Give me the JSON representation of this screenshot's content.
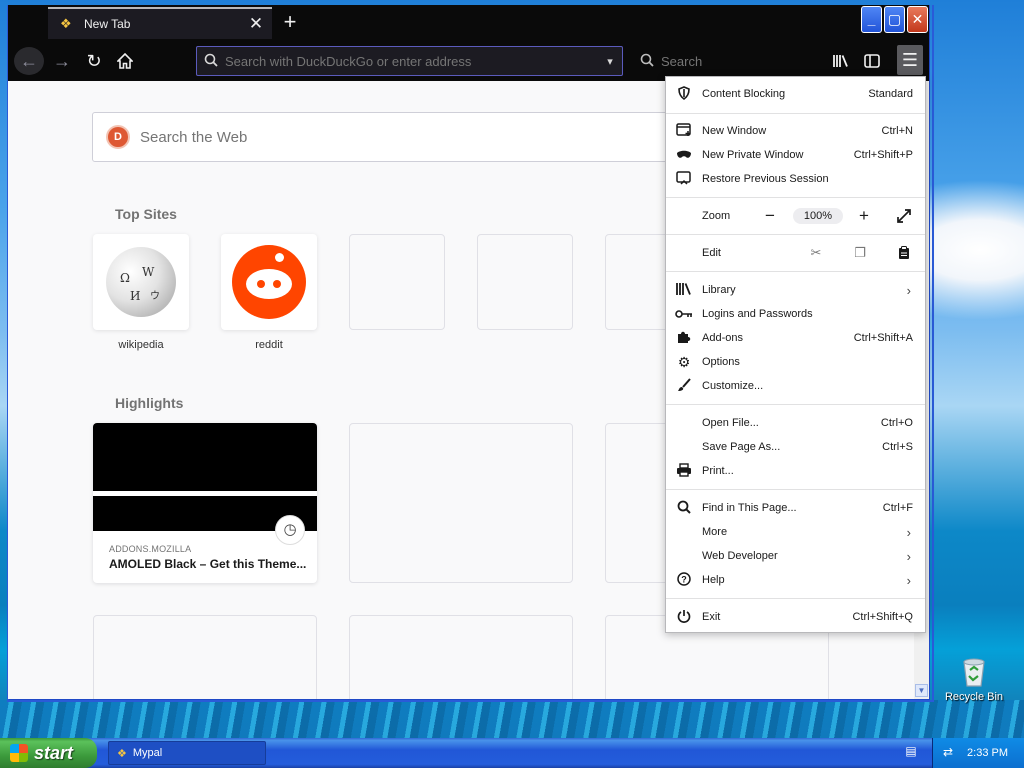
{
  "tab": {
    "title": "New Tab",
    "close": "✕",
    "new": "+"
  },
  "window_controls": {
    "minimize": "_",
    "maximize": "▢",
    "close": "✕"
  },
  "urlbar": {
    "placeholder": "Search with DuckDuckGo or enter address"
  },
  "searchbar": {
    "placeholder": "Search"
  },
  "content": {
    "websearch_placeholder": "Search the Web",
    "top_sites_heading": "Top Sites",
    "top_sites": [
      {
        "label": "wikipedia"
      },
      {
        "label": "reddit"
      }
    ],
    "highlights_heading": "Highlights",
    "highlight": {
      "source": "ADDONS.MOZILLA",
      "title": "AMOLED Black – Get this Theme..."
    }
  },
  "menu": {
    "content_blocking": {
      "label": "Content Blocking",
      "value": "Standard"
    },
    "new_window": {
      "label": "New Window",
      "shortcut": "Ctrl+N"
    },
    "new_private_window": {
      "label": "New Private Window",
      "shortcut": "Ctrl+Shift+P"
    },
    "restore_session": {
      "label": "Restore Previous Session"
    },
    "zoom": {
      "label": "Zoom",
      "level": "100%"
    },
    "edit": {
      "label": "Edit"
    },
    "library": {
      "label": "Library"
    },
    "logins": {
      "label": "Logins and Passwords"
    },
    "addons": {
      "label": "Add-ons",
      "shortcut": "Ctrl+Shift+A"
    },
    "options": {
      "label": "Options"
    },
    "customize": {
      "label": "Customize..."
    },
    "open_file": {
      "label": "Open File...",
      "shortcut": "Ctrl+O"
    },
    "save_page": {
      "label": "Save Page As...",
      "shortcut": "Ctrl+S"
    },
    "print": {
      "label": "Print..."
    },
    "find": {
      "label": "Find in This Page...",
      "shortcut": "Ctrl+F"
    },
    "more": {
      "label": "More"
    },
    "web_developer": {
      "label": "Web Developer"
    },
    "help": {
      "label": "Help"
    },
    "exit": {
      "label": "Exit",
      "shortcut": "Ctrl+Shift+Q"
    }
  },
  "desktop": {
    "recycle_bin": "Recycle Bin"
  },
  "taskbar": {
    "start": "start",
    "task": "Mypal",
    "clock": "2:33 PM"
  }
}
